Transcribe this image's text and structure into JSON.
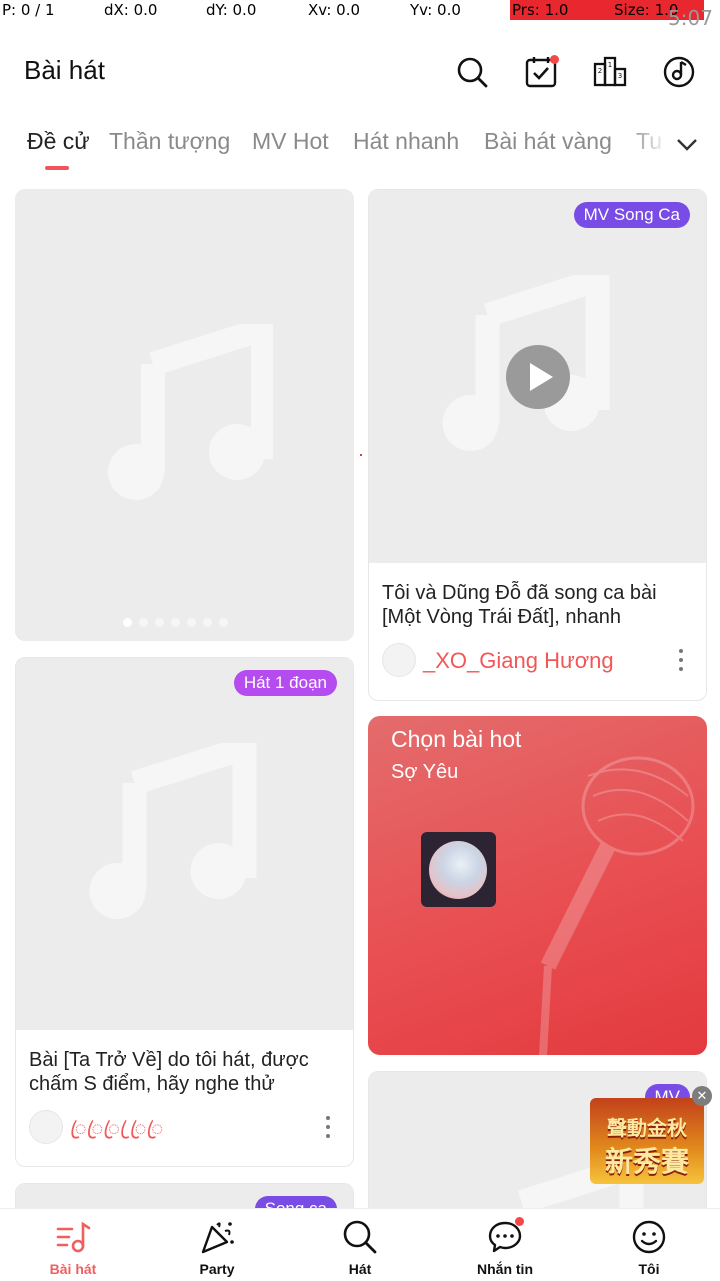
{
  "status": {
    "p": "P: 0 / 1",
    "dx": "dX: 0.0",
    "dy": "dY: 0.0",
    "xv": "Xv: 0.0",
    "yv": "Yv: 0.0",
    "prs": "Prs: 1.0",
    "size": "Size: 1.0",
    "time": "5:07"
  },
  "header": {
    "title": "Bài hát",
    "icons": [
      "search-icon",
      "task-check-icon",
      "leaderboard-icon",
      "music-disc-icon"
    ]
  },
  "tabs": [
    "Đề cử",
    "Thần tượng",
    "MV Hot",
    "Hát nhanh",
    "Bài hát vàng",
    "Tu"
  ],
  "active_tab": "Đề cử",
  "cards": {
    "banner": {
      "pages": 7,
      "active_page": 1
    },
    "mv_song_ca": {
      "badge": "MV Song Ca",
      "caption": "Tôi và Dũng Đỗ đã song ca bài [Một Vòng Trái Đất], nhanh",
      "user": "_XO_Giang Hương"
    },
    "hat_1_doan": {
      "badge": "Hát 1 đoạn",
      "caption": "Bài [Ta Trở Về] do tôi hát, được chấm S điểm, hãy nghe thử",
      "user": "ꦿꦿꦿ ꦿꦿꦿ"
    },
    "hot": {
      "title": "Chọn bài hot",
      "song": "Sợ Yêu"
    },
    "partial_left": {
      "badge": "Song ca"
    },
    "partial_right": {
      "badge": "MV"
    }
  },
  "promo": {
    "line1": "聲動金秋",
    "line2": "新秀賽",
    "close": "✕"
  },
  "bottom_nav": [
    {
      "label": "Bài hát",
      "icon": "song-list-icon",
      "active": true
    },
    {
      "label": "Party",
      "icon": "party-popper-icon"
    },
    {
      "label": "Hát",
      "icon": "search-sing-icon"
    },
    {
      "label": "Nhắn tin",
      "icon": "chat-bubble-icon",
      "badge": true
    },
    {
      "label": "Tôi",
      "icon": "smiley-face-icon"
    }
  ],
  "colors": {
    "accent": "#f2545b",
    "badge_purple": "#7a4ce6",
    "hot_red": "#e84e52"
  }
}
